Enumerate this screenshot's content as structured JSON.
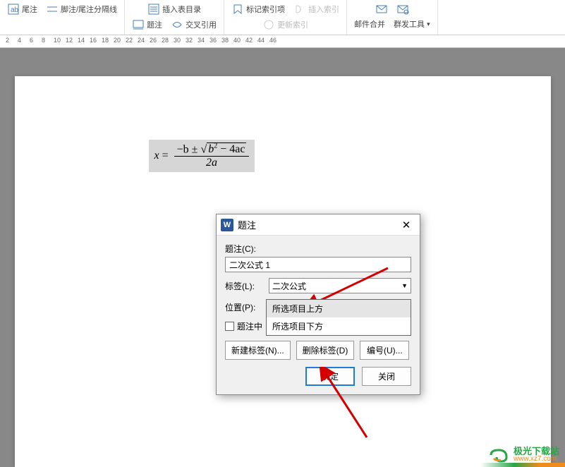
{
  "ribbon": {
    "group1": {
      "item1": "尾注",
      "item2": "脚注/尾注分隔线"
    },
    "group2": {
      "item1": "插入表目录",
      "item2": "交叉引用",
      "label": "题注"
    },
    "group3": {
      "item1": "标记索引项",
      "item2": "更新索引",
      "insert_index": "插入索引"
    },
    "group4": {
      "item1": "邮件合并",
      "item2": "群发工具"
    }
  },
  "ruler_ticks": [
    "2",
    "4",
    "6",
    "8",
    "10",
    "12",
    "14",
    "16",
    "18",
    "20",
    "22",
    "24",
    "26",
    "28",
    "30",
    "32",
    "34",
    "36",
    "38",
    "40",
    "42",
    "44",
    "46"
  ],
  "formula": {
    "lhs": "x",
    "eq": "=",
    "num_b": "−b ±",
    "b2": "b",
    "sq": "2",
    "minus4ac": "− 4ac",
    "den": "2a"
  },
  "dialog": {
    "title": "题注",
    "caption_label": "题注(C):",
    "caption_value": "二次公式 1",
    "label_label": "标签(L):",
    "label_value": "二次公式",
    "position_label": "位置(P):",
    "position_value": "所选项目下方",
    "dropdown": {
      "opt1": "所选项目上方",
      "opt2": "所选项目下方"
    },
    "checkbox_label": "题注中",
    "btn_new": "新建标签(N)...",
    "btn_del": "删除标签(D)",
    "btn_num": "编号(U)...",
    "btn_ok": "确定",
    "btn_close": "关闭"
  },
  "watermark": {
    "cn": "极光下载站",
    "en": "www.xz7.com"
  }
}
